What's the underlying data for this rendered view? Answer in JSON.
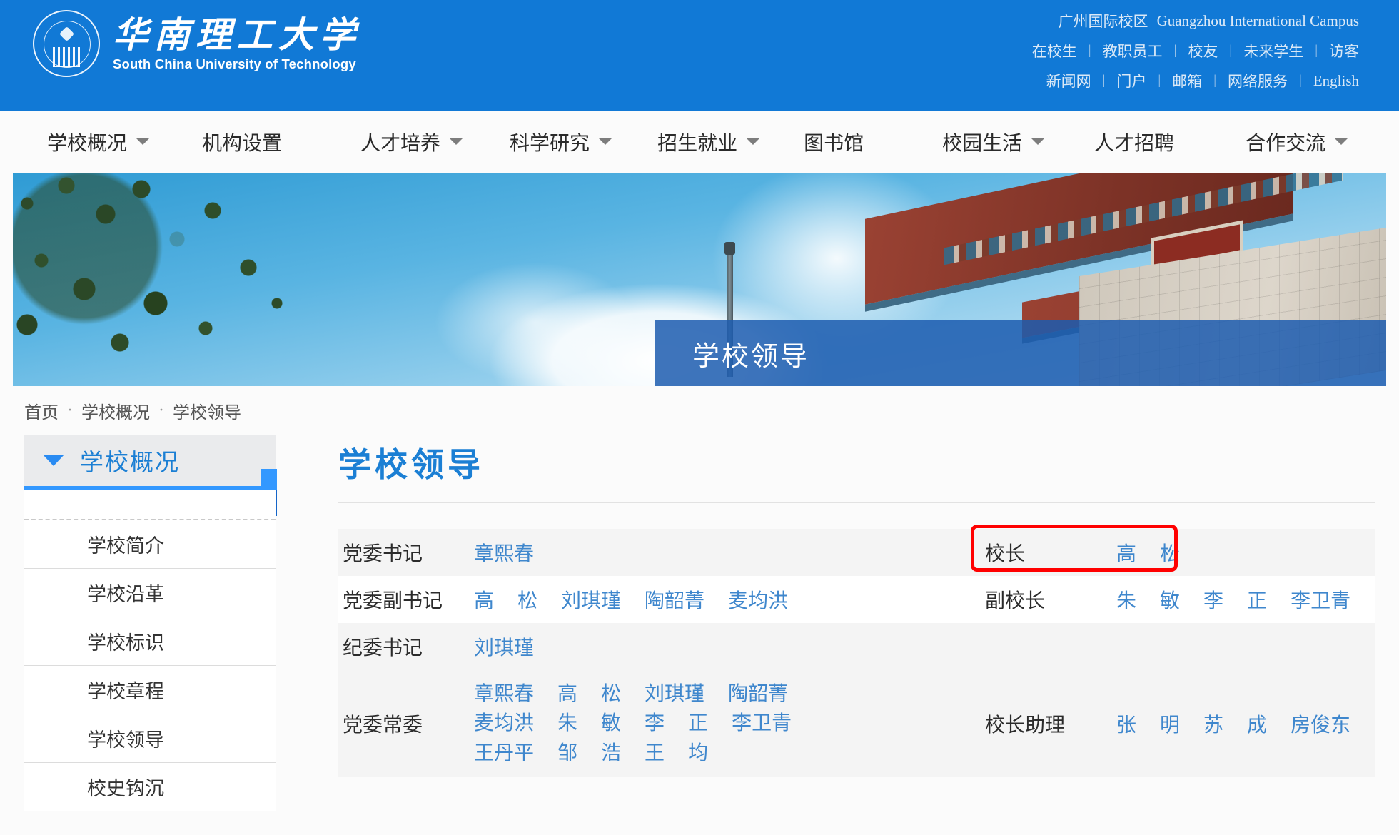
{
  "site": {
    "logo_cn": "华南理工大学",
    "logo_en": "South China University of Technology",
    "seal_alt": "university-seal"
  },
  "top_links": {
    "campus_cn": "广州国际校区",
    "campus_en": "Guangzhou International Campus",
    "row1": [
      "在校生",
      "教职员工",
      "校友",
      "未来学生",
      "访客"
    ],
    "row2": [
      "新闻网",
      "门户",
      "邮箱",
      "网络服务",
      "English"
    ],
    "separator": "|"
  },
  "main_nav": [
    {
      "label": "学校概况",
      "has_dropdown": true
    },
    {
      "label": "机构设置",
      "has_dropdown": false
    },
    {
      "label": "人才培养",
      "has_dropdown": true
    },
    {
      "label": "科学研究",
      "has_dropdown": true
    },
    {
      "label": "招生就业",
      "has_dropdown": true
    },
    {
      "label": "图书馆",
      "has_dropdown": false
    },
    {
      "label": "校园生活",
      "has_dropdown": true
    },
    {
      "label": "人才招聘",
      "has_dropdown": false
    },
    {
      "label": "合作交流",
      "has_dropdown": true
    }
  ],
  "banner": {
    "overlay_title": "学校领导",
    "image_alt": "campus-traditional-architecture-photo"
  },
  "breadcrumb": {
    "items": [
      "首页",
      "学校概况",
      "学校领导"
    ],
    "separator": "·"
  },
  "sidebar": {
    "header": "学校概况",
    "items": [
      {
        "label": "学校简介"
      },
      {
        "label": "学校沿革"
      },
      {
        "label": "学校标识"
      },
      {
        "label": "学校章程"
      },
      {
        "label": "学校领导"
      },
      {
        "label": "校史钩沉"
      }
    ]
  },
  "main": {
    "page_title": "学校领导",
    "table": {
      "rows": [
        {
          "left_role": "党委书记",
          "left_names": [
            "章熙春"
          ],
          "right_role": "校长",
          "right_names": [
            "高",
            "松"
          ],
          "right_highlight": true
        },
        {
          "left_role": "党委副书记",
          "left_names": [
            "高",
            "松",
            "刘琪瑾",
            "陶韶菁",
            "麦均洪"
          ],
          "right_role": "副校长",
          "right_names": [
            "朱",
            "敏",
            "李",
            "正",
            "李卫青"
          ],
          "right_highlight": false
        },
        {
          "left_role": "纪委书记",
          "left_names": [
            "刘琪瑾"
          ],
          "right_role": "",
          "right_names": [],
          "right_highlight": false
        },
        {
          "left_role": "党委常委",
          "left_name_lines": [
            [
              "章熙春",
              "高",
              "松",
              "刘琪瑾",
              "陶韶菁"
            ],
            [
              "麦均洪",
              "朱",
              "敏",
              "李",
              "正",
              "李卫青"
            ],
            [
              "王丹平",
              "邹",
              "浩",
              "王",
              "均"
            ]
          ],
          "right_role": "校长助理",
          "right_names": [
            "张",
            "明",
            "苏",
            "成",
            "房俊东"
          ],
          "right_highlight": false
        }
      ]
    }
  },
  "colors": {
    "header_blue": "#1179d6",
    "accent_blue": "#1b7fd4",
    "link_blue": "#3f87cd",
    "overlay_blue": "#1c5caf",
    "highlight_red": "#ff0000",
    "sidebar_head_bg": "#eaebed",
    "row_odd_bg": "#f4f4f4"
  }
}
